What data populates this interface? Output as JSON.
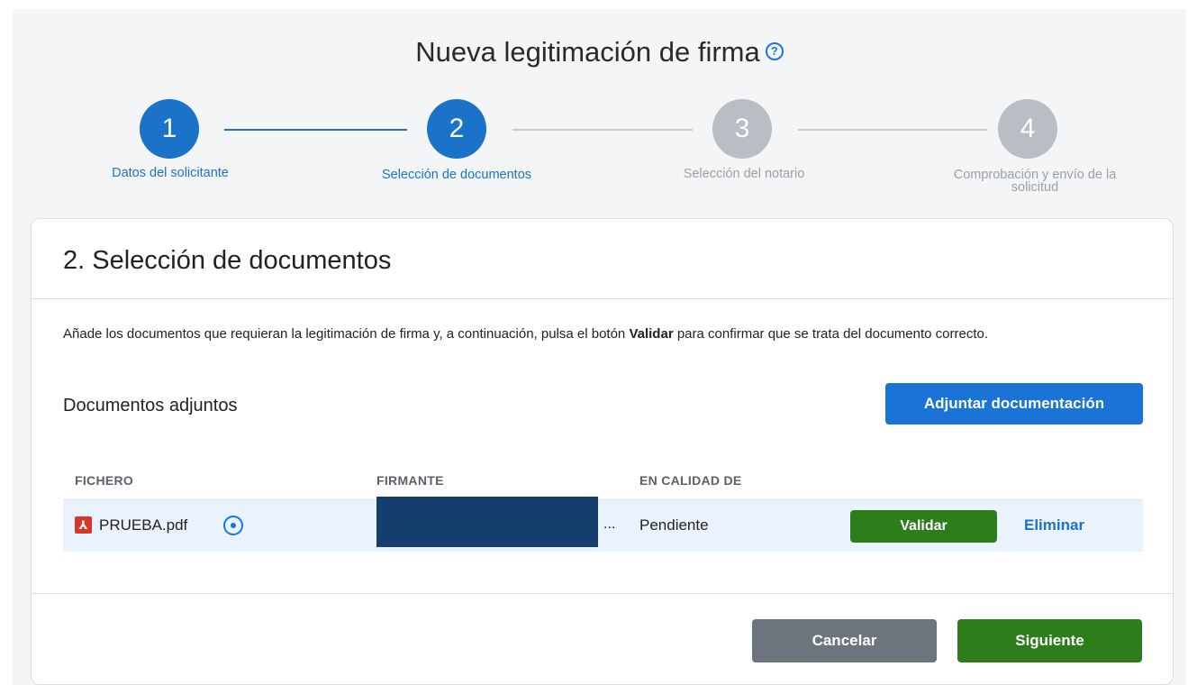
{
  "page_title": "Nueva legitimación de firma",
  "help_icon": "question-circle-icon",
  "stepper": {
    "steps": [
      {
        "number": "1",
        "label": "Datos del solicitante",
        "state": "active"
      },
      {
        "number": "2",
        "label": "Selección de documentos",
        "state": "active"
      },
      {
        "number": "3",
        "label": "Selección del notario",
        "state": "inactive"
      },
      {
        "number": "4",
        "label_line1": "Comprobación y envío de la",
        "label_line2": "solicitud",
        "state": "inactive"
      }
    ]
  },
  "card": {
    "title": "2. Selección de documentos",
    "instructions_part1": "Añade los documentos que requieran la legitimación de firma y, a continuación, pulsa el botón ",
    "instructions_bold": "Validar",
    "instructions_part2": " para confirmar que se trata del documento correcto.",
    "subtitle": "Documentos adjuntos",
    "attach_button": "Adjuntar documentación"
  },
  "table": {
    "headers": [
      "FICHERO",
      "FIRMANTE",
      "EN CALIDAD DE"
    ],
    "rows": [
      {
        "file_icon": "pdf-icon",
        "file_name": "PRUEBA.pdf",
        "preview_icon": "eye-icon",
        "signer_ellipsis": "...",
        "status": "Pendiente",
        "validate_label": "Validar",
        "delete_label": "Eliminar"
      }
    ]
  },
  "footer": {
    "cancel_label": "Cancelar",
    "next_label": "Siguiente"
  },
  "colors": {
    "primary_blue": "#1a73c8",
    "green": "#2d7d1a",
    "gray_button": "#6c757d",
    "inactive_step": "#b8bec4"
  }
}
